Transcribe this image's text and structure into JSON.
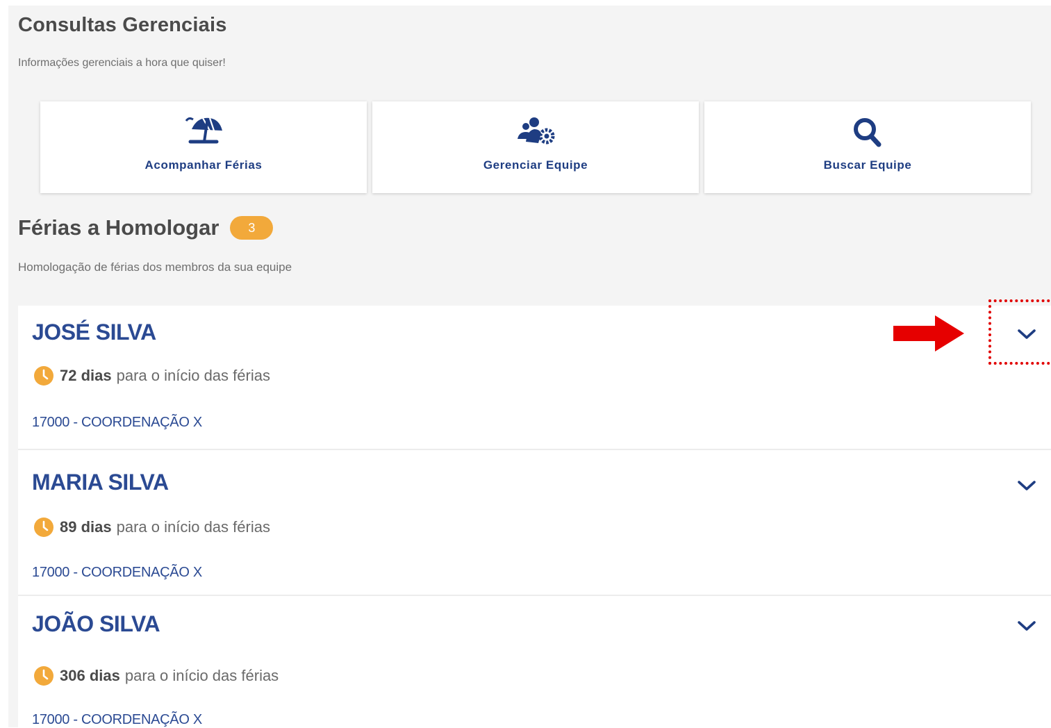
{
  "header": {
    "title": "Consultas Gerenciais",
    "subtitle": "Informações gerenciais a hora que quiser!"
  },
  "cards": [
    {
      "label": "Acompanhar Férias",
      "icon": "beach-umbrella-icon"
    },
    {
      "label": "Gerenciar Equipe",
      "icon": "team-settings-icon"
    },
    {
      "label": "Buscar Equipe",
      "icon": "search-icon"
    }
  ],
  "section": {
    "title": "Férias a Homologar",
    "badge": "3",
    "subtitle": "Homologação de férias dos membros da sua equipe"
  },
  "employees": [
    {
      "name": "JOSÉ SILVA",
      "days": "72 dias",
      "days_suffix": "para o início das férias",
      "department": "17000 - COORDENAÇÃO X"
    },
    {
      "name": "MARIA SILVA",
      "days": "89 dias",
      "days_suffix": "para o início das férias",
      "department": "17000 - COORDENAÇÃO X"
    },
    {
      "name": "JOÃO SILVA",
      "days": "306 dias",
      "days_suffix": "para o início das férias",
      "department": "17000 - COORDENAÇÃO X"
    }
  ],
  "colors": {
    "primary": "#1e3d82",
    "name": "#2b4a93",
    "badge": "#f2a93b",
    "annotation": "#e10000",
    "background": "#f4f4f4"
  }
}
